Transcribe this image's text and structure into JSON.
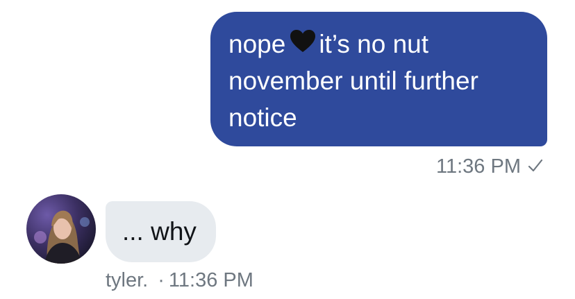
{
  "outgoing": {
    "lines": [
      "nope",
      "it’s no nut",
      "november until further",
      "notice"
    ],
    "emoji": "black-heart-icon",
    "time": "11:36 PM",
    "status": "✓"
  },
  "incoming": {
    "text": "... why",
    "sender": "tyler.",
    "separator": "·",
    "time": "11:36 PM"
  },
  "colors": {
    "outgoing_bubble": "#2f4a9c",
    "incoming_bubble": "#e7ebef",
    "meta_text": "#6e7780"
  }
}
